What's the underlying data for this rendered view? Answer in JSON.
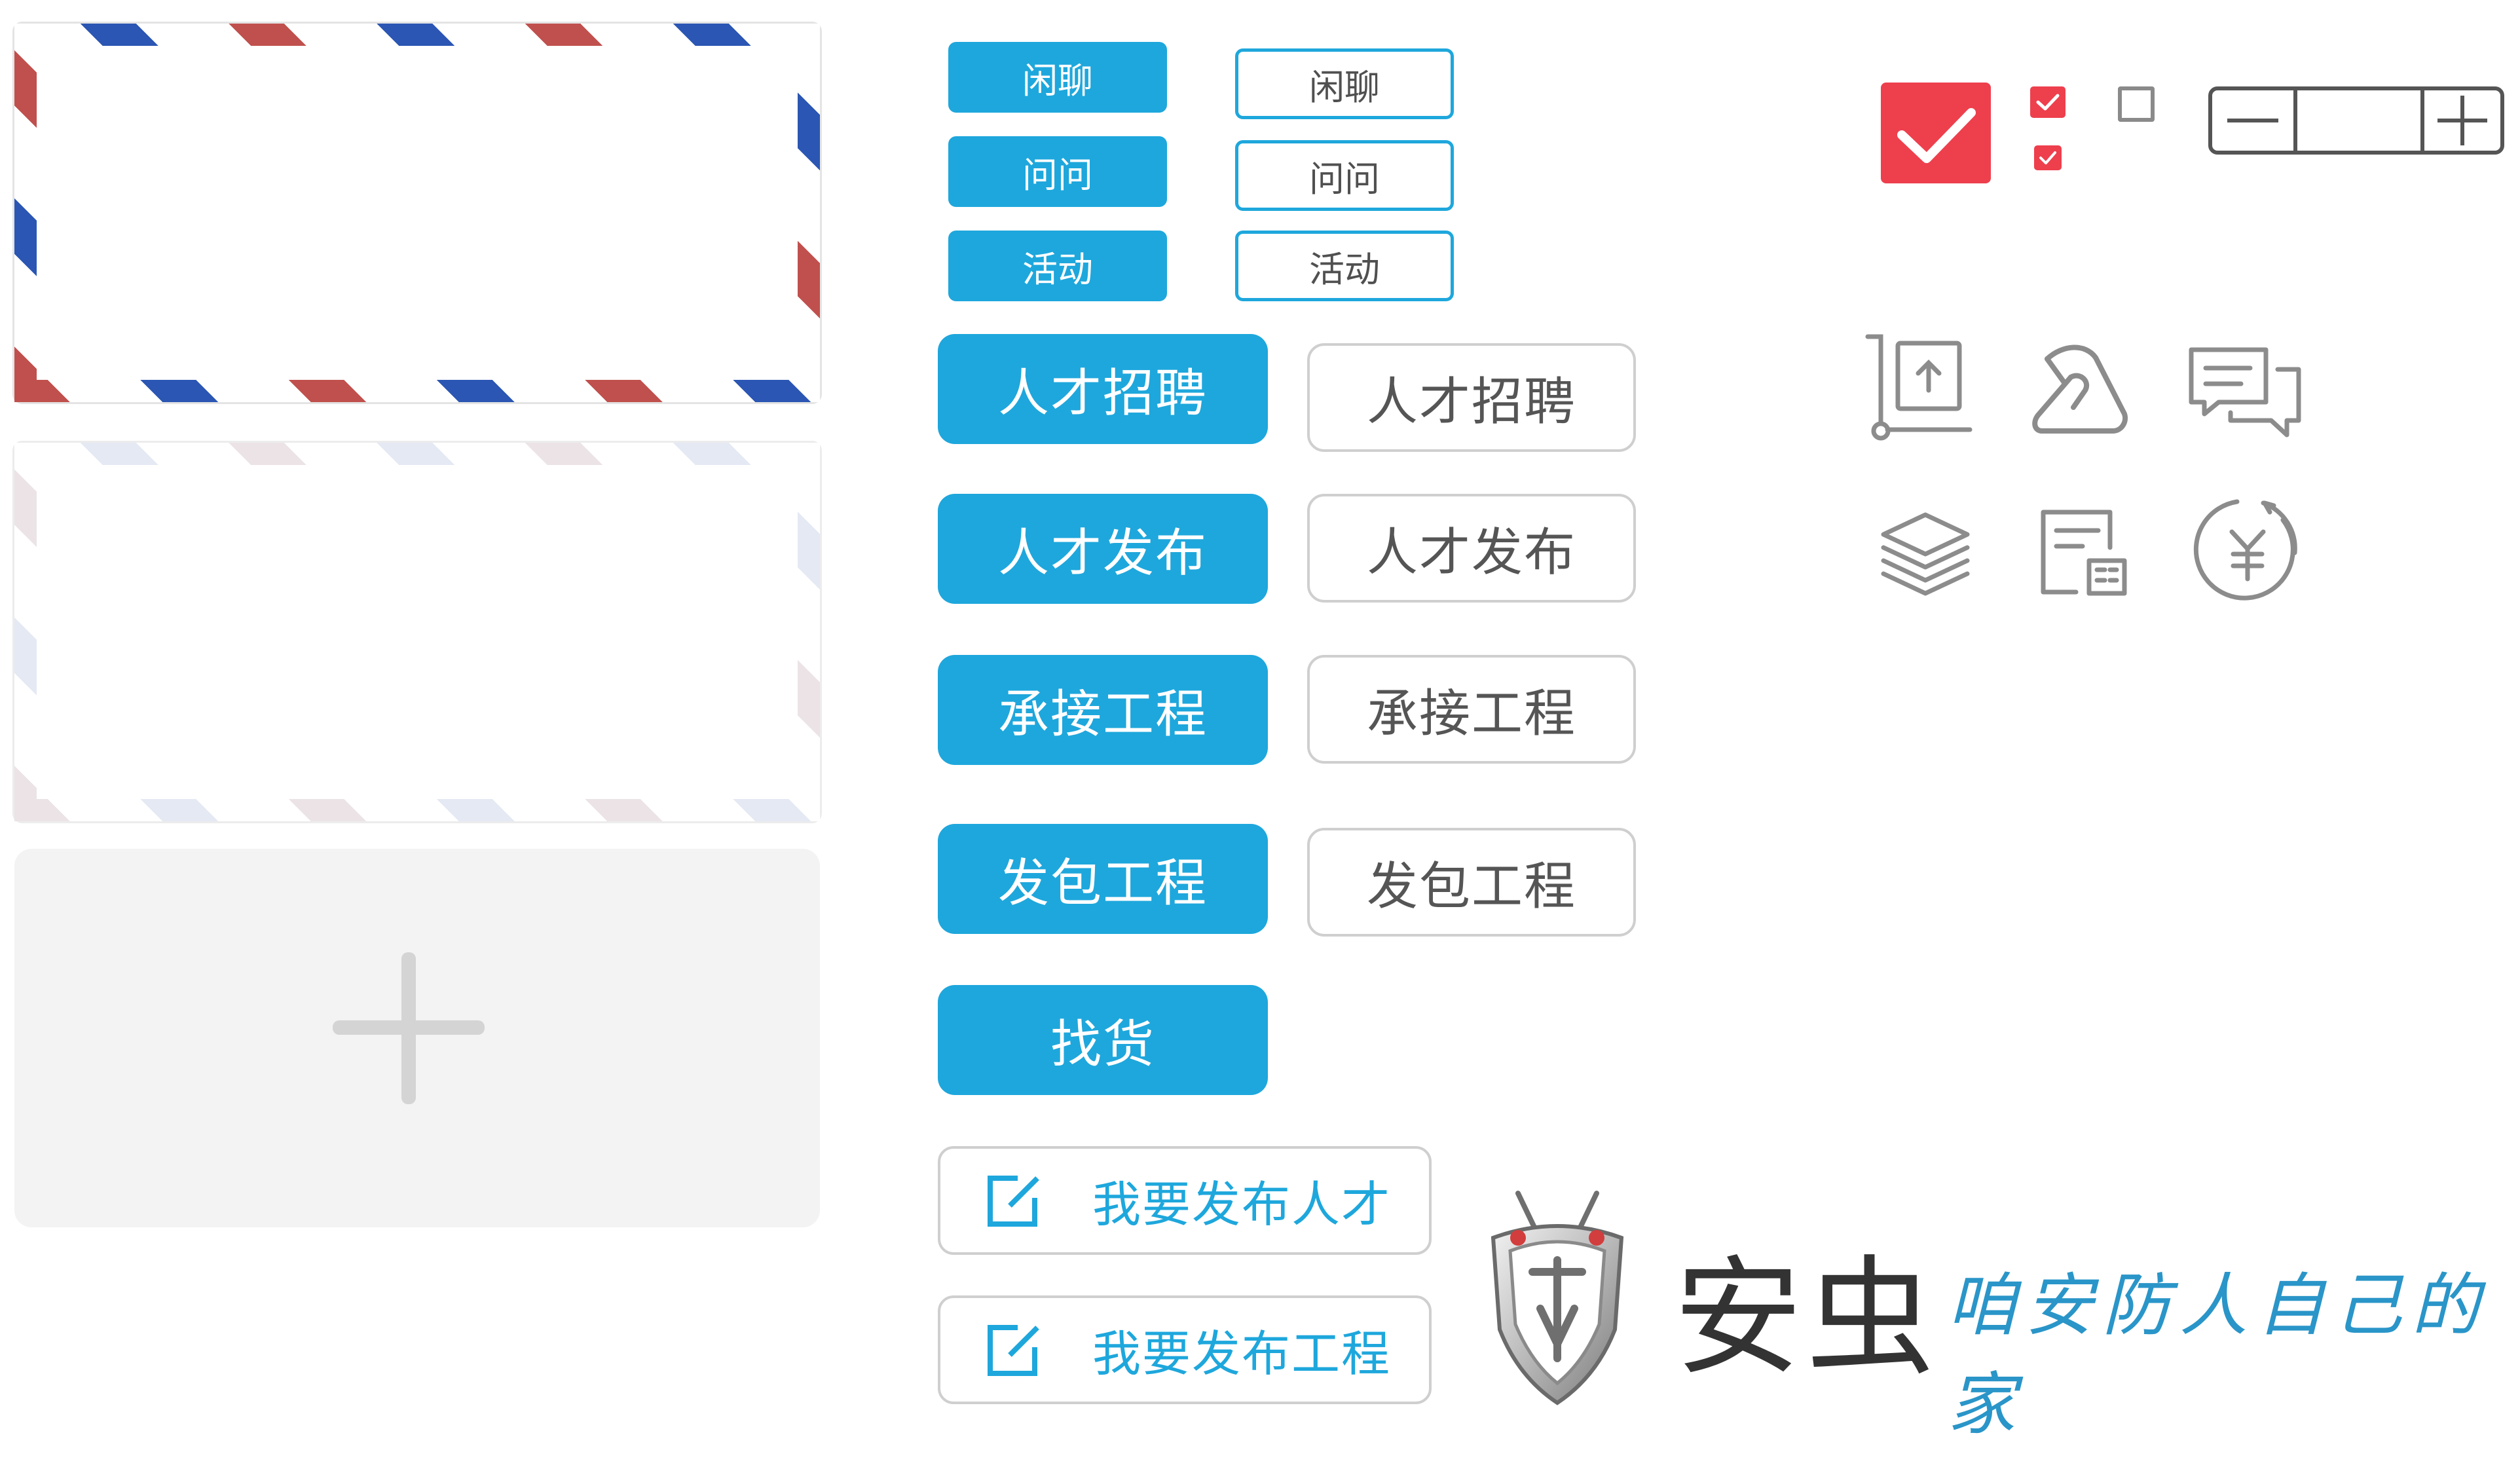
{
  "colors": {
    "accent": "#1ea7dc",
    "check_red": "#ee3f4d",
    "airmail_red": "#c0504d",
    "airmail_blue": "#2b56b3",
    "gray_icon": "#8c8c8c"
  },
  "small_buttons": {
    "filled": [
      "闲聊",
      "问问",
      "活动"
    ],
    "outlined": [
      "闲聊",
      "问问",
      "活动"
    ]
  },
  "large_buttons": {
    "filled": [
      "人才招聘",
      "人才发布",
      "承接工程",
      "发包工程",
      "找货"
    ],
    "outlined": [
      "人才招聘",
      "人才发布",
      "承接工程",
      "发包工程"
    ]
  },
  "post_buttons": [
    {
      "label": "我要发布人才",
      "icon": "edit-icon"
    },
    {
      "label": "我要发布工程",
      "icon": "edit-icon"
    }
  ],
  "controls": {
    "checkbox_large_checked": true,
    "checkbox_small_1_checked": true,
    "checkbox_small_2_checked": true,
    "checkbox_empty_checked": false,
    "stepper_value": "",
    "stepper_minus": "−",
    "stepper_plus": "+"
  },
  "icons": [
    "upload-cart-icon",
    "bid-hand-icon",
    "chat-bubbles-icon",
    "layers-icon",
    "building-doc-icon",
    "yuan-coin-icon"
  ],
  "brand": {
    "logo": "shield-logo",
    "name": "安虫",
    "slogan": "咱安防人自己的家"
  }
}
